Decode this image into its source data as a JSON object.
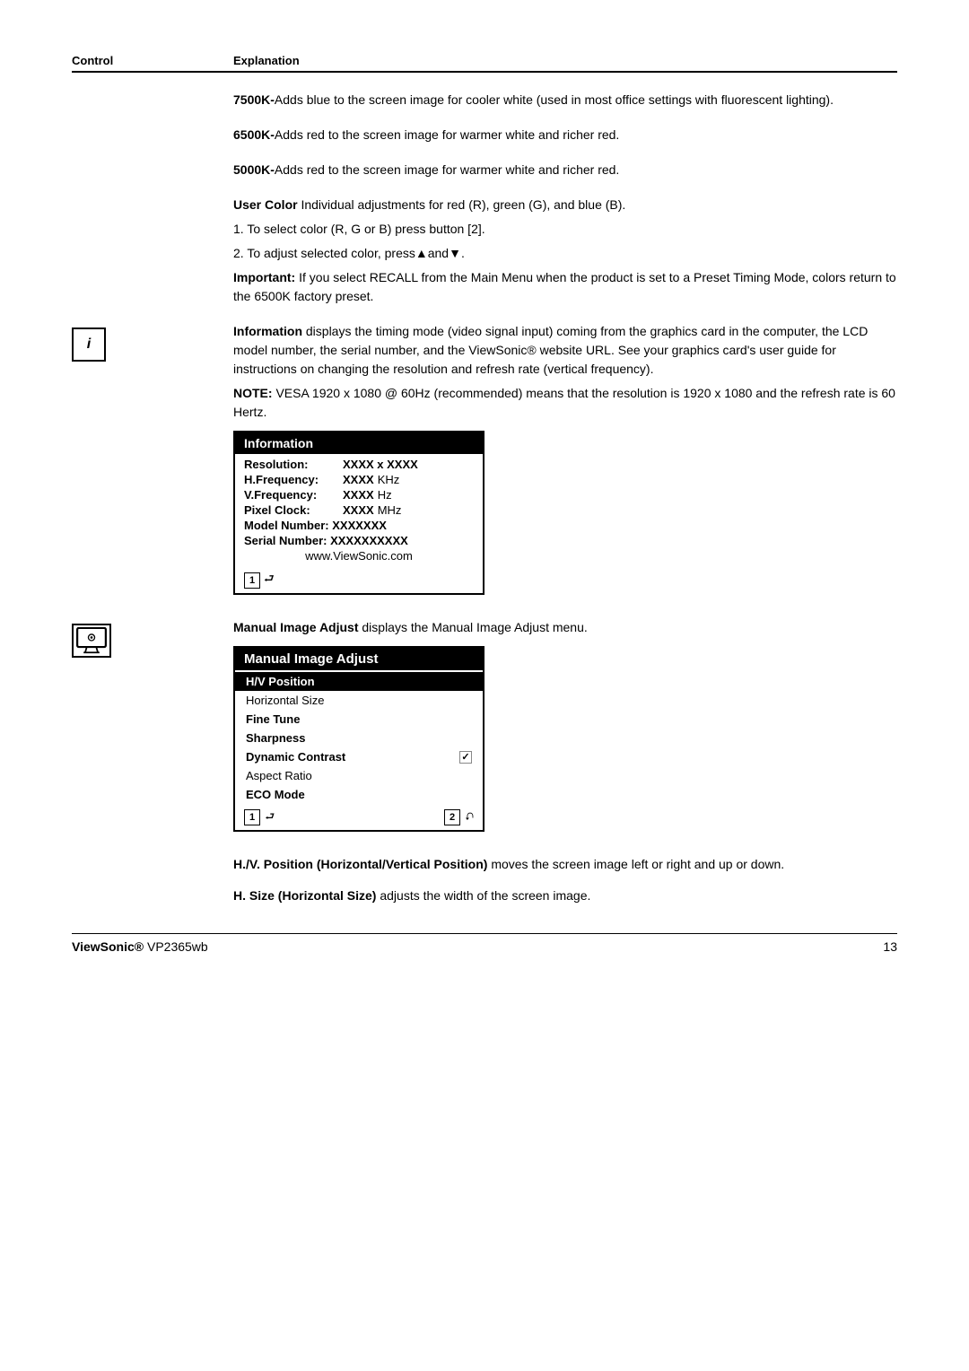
{
  "table": {
    "header": {
      "control": "Control",
      "explanation": "Explanation"
    }
  },
  "content": {
    "k7500": {
      "label": "7500K-",
      "text": "Adds blue to the screen image for cooler white (used in most office settings with fluorescent lighting)."
    },
    "k6500": {
      "label": "6500K-",
      "text": "Adds red to the screen image for warmer white and richer red."
    },
    "k5000": {
      "label": "5000K-",
      "text": "Adds red to the screen image for warmer white and richer red."
    },
    "userColor": {
      "label": "User Color ",
      "text1": " Individual adjustments for red (R), green (G),  and blue (B).",
      "step1": "1.  To select color (R, G or B) press button [2].",
      "step2_prefix": "2.  To adjust selected color, press",
      "importantLabel": "Important: ",
      "importantText": "If you select RECALL from the Main Menu when the product is set to a Preset Timing Mode, colors return to the 6500K factory preset."
    },
    "information": {
      "label": "Information ",
      "text1": "displays the timing mode (video signal input) coming from the graphics card in the computer, the LCD model number, the serial number, and the ViewSonic® website URL. See your graphics card's user guide for instructions on changing the resolution and refresh rate (vertical frequency).",
      "noteLabel": "NOTE: ",
      "noteText": "VESA 1920 x 1080 @ 60Hz (recommended) means that the resolution is 1920 x 1080 and the refresh rate is 60 Hertz."
    },
    "mia": {
      "label": "Manual Image Adjust ",
      "text": "displays the Manual Image Adjust menu."
    },
    "hvPosition": {
      "label": "H./V. Position (Horizontal/Vertical Position) ",
      "text": "moves the screen image left or right and up or down."
    },
    "hSize": {
      "label": "H. Size (Horizontal Size) ",
      "text": "adjusts the width of the screen image."
    }
  },
  "infoBox": {
    "title": "Information",
    "rows": [
      {
        "label": "Resolution:",
        "value": "XXXX x XXXX",
        "unit": ""
      },
      {
        "label": "H.Frequency:",
        "value": "XXXX",
        "unit": "KHz"
      },
      {
        "label": "V.Frequency:",
        "value": "XXXX",
        "unit": "Hz"
      },
      {
        "label": "Pixel Clock:",
        "value": "XXXX",
        "unit": "MHz"
      }
    ],
    "modelRow": "Model Number: XXXXXXX",
    "serialRow": "Serial Number: XXXXXXXXXX",
    "url": "www.ViewSonic.com",
    "footer": {
      "badge": "1",
      "icon": "⮐"
    }
  },
  "miaBox": {
    "title": "Manual Image Adjust",
    "items": [
      {
        "label": "H/V Position"
      },
      {
        "label": "Horizontal Size"
      },
      {
        "label": "Fine Tune"
      },
      {
        "label": "Sharpness"
      },
      {
        "label": "Dynamic Contrast"
      },
      {
        "label": "Aspect Ratio"
      },
      {
        "label": "ECO Mode"
      }
    ],
    "footer": {
      "badge1": "1",
      "icon1": "⮐",
      "badge2": "2",
      "icon2": "⮏"
    }
  },
  "footer": {
    "brand": "ViewSonic®",
    "model": " VP2365wb",
    "page": "13"
  }
}
